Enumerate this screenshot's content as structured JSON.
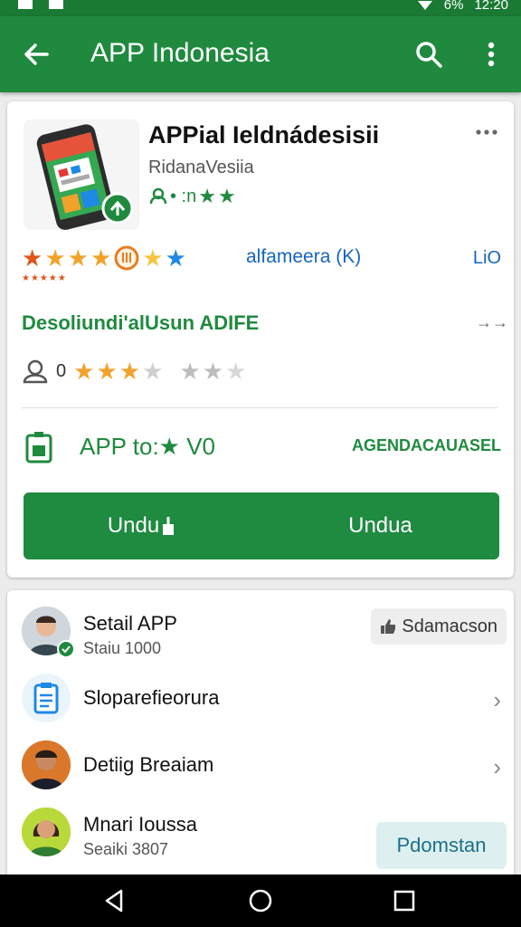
{
  "status_bar": {
    "time": "12:20",
    "battery": "6%"
  },
  "appbar": {
    "title": "APP Indonesia"
  },
  "app": {
    "name": "APPial Ieldnádesisii",
    "developer": "RidanaVesiia",
    "meta": "• :n"
  },
  "rating": {
    "text": "alfameera (K)",
    "link": "LiO",
    "tiny": "★★★★★"
  },
  "section": {
    "title": "Desoliundi'alUsun ADIFE",
    "arrow": "→→"
  },
  "user_rating": {
    "count": "0"
  },
  "install": {
    "text": "APP to:★ V0",
    "link": "AGENDACAUASEL"
  },
  "buttons": {
    "left": "Undu",
    "right": "Undua"
  },
  "list": [
    {
      "title": "Setail APP",
      "sub": "Staiu 1000",
      "chip": "Sdamacson"
    },
    {
      "title": "Sloparefieorura"
    },
    {
      "title": "Detiig Breaiam"
    },
    {
      "title": "Mnari Ioussa",
      "sub": "Seaiki 3807",
      "chip": "Pdomstan"
    }
  ],
  "colors": {
    "primary": "#1f8a3e",
    "star_orange": "#f2a22b",
    "star_blue": "#1e88e5",
    "link_blue": "#1565c0"
  },
  "icons": [
    "back-arrow-icon",
    "search-icon",
    "more-vert-icon",
    "more-horiz-icon",
    "person-icon",
    "battery-icon",
    "like-icon",
    "clipboard-icon",
    "chevron-right-icon",
    "nav-back-icon",
    "nav-home-icon",
    "nav-recents-icon"
  ]
}
